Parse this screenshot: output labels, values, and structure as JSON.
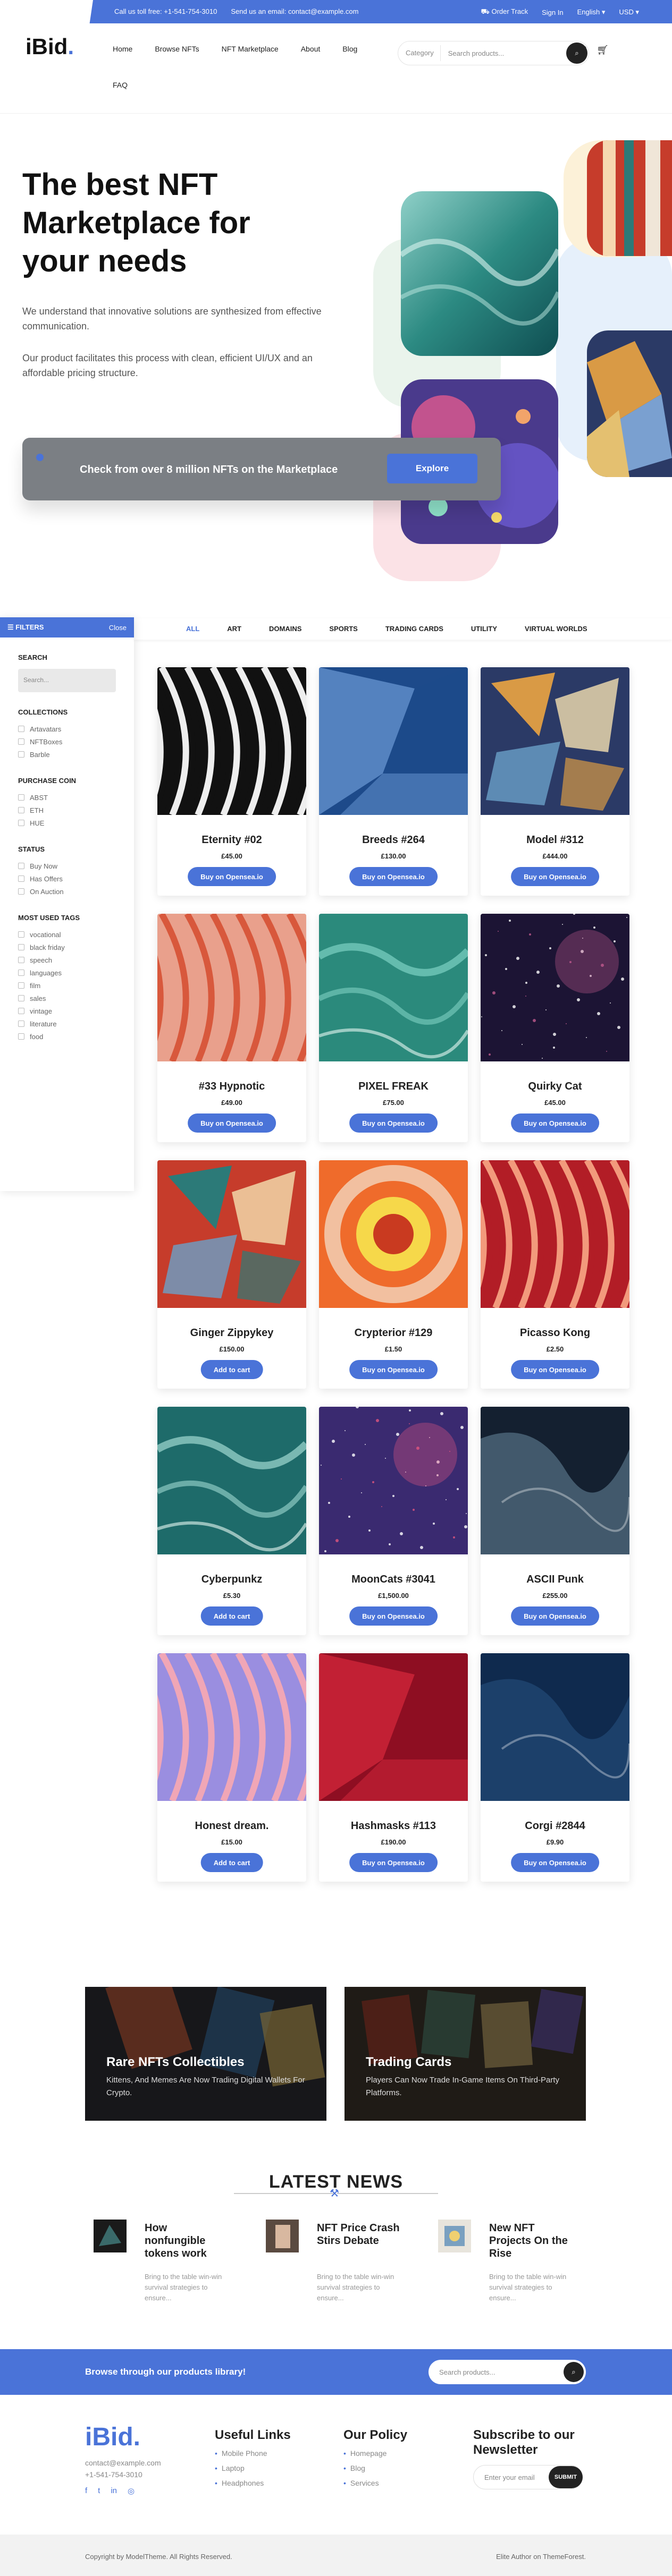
{
  "topbar": {
    "call": "Call us toll free: +1-541-754-3010",
    "email": "Send us an email: contact@example.com",
    "order_track": "Order Track",
    "sign_in": "Sign In",
    "language": "English",
    "currency": "USD"
  },
  "header": {
    "logo_text": "iBid",
    "logo_dot": ".",
    "nav": [
      "Home",
      "Browse NFTs",
      "NFT Marketplace",
      "About",
      "Blog"
    ],
    "nav_second_row": "FAQ",
    "search": {
      "category": "Category",
      "placeholder": "Search products..."
    }
  },
  "hero": {
    "title": "The best NFT Marketplace for your needs",
    "p1": "We understand that innovative solutions are synthesized from effective communication.",
    "p2": "Our product facilitates this process with clean, efficient UI/UX and an affordable pricing structure.",
    "cta_text": "Check from over 8 million NFTs on the Marketplace",
    "cta_button": "Explore"
  },
  "filters": {
    "title": "FILTERS",
    "close": "Close",
    "search_heading": "SEARCH",
    "search_placeholder": "Search...",
    "collections_heading": "COLLECTIONS",
    "collections": [
      "Artavatars",
      "NFTBoxes",
      "Barble"
    ],
    "coin_heading": "PURCHASE COIN",
    "coins": [
      "ABST",
      "ETH",
      "HUE"
    ],
    "status_heading": "STATUS",
    "status": [
      "Buy Now",
      "Has Offers",
      "On Auction"
    ],
    "tags_heading": "MOST USED TAGS",
    "tags": [
      "vocational",
      "black friday",
      "speech",
      "languages",
      "film",
      "sales",
      "vintage",
      "literature",
      "food"
    ]
  },
  "tabs": [
    "ALL",
    "ART",
    "DOMAINS",
    "SPORTS",
    "TRADING CARDS",
    "UTILITY",
    "VIRTUAL WORLDS"
  ],
  "products": [
    {
      "title": "Eternity #02",
      "price": "£45.00",
      "button": "Buy on Opensea.io",
      "colors": [
        "#111",
        "#eee"
      ],
      "pattern": "stripes"
    },
    {
      "title": "Breeds #264",
      "price": "£130.00",
      "button": "Buy on Opensea.io",
      "colors": [
        "#1d4a8a",
        "#6c9ad6"
      ],
      "pattern": "geo"
    },
    {
      "title": "Model #312",
      "price": "£444.00",
      "button": "Buy on Opensea.io",
      "colors": [
        "#2b3a66",
        "#d99a45"
      ],
      "pattern": "shards"
    },
    {
      "title": "#33 Hypnotic",
      "price": "£49.00",
      "button": "Buy on Opensea.io",
      "colors": [
        "#e9a08c",
        "#d8583c"
      ],
      "pattern": "stripes"
    },
    {
      "title": "PIXEL FREAK",
      "price": "£75.00",
      "button": "Buy on Opensea.io",
      "colors": [
        "#2b8a7c",
        "#7ed1c3"
      ],
      "pattern": "water"
    },
    {
      "title": "Quirky Cat",
      "price": "£45.00",
      "button": "Buy on Opensea.io",
      "colors": [
        "#1c1434",
        "#c05a8e"
      ],
      "pattern": "space"
    },
    {
      "title": "Ginger Zippykey",
      "price": "£150.00",
      "button": "Add to cart",
      "colors": [
        "#c63c2b",
        "#2c7a78"
      ],
      "pattern": "shards"
    },
    {
      "title": "Crypterior #129",
      "price": "£1.50",
      "button": "Buy on Opensea.io",
      "colors": [
        "#ef6b2b",
        "#f6d84a"
      ],
      "pattern": "rings"
    },
    {
      "title": "Picasso Kong",
      "price": "£2.50",
      "button": "Buy on Opensea.io",
      "colors": [
        "#b21d26",
        "#f29a7c"
      ],
      "pattern": "stripes"
    },
    {
      "title": "Cyberpunkz",
      "price": "£5.30",
      "button": "Add to cart",
      "colors": [
        "#1e6b6a",
        "#9fd8d2"
      ],
      "pattern": "water"
    },
    {
      "title": "MoonCats #3041",
      "price": "£1,500.00",
      "button": "Buy on Opensea.io",
      "colors": [
        "#3a2a70",
        "#e25680"
      ],
      "pattern": "space"
    },
    {
      "title": "ASCII Punk",
      "price": "£255.00",
      "button": "Buy on Opensea.io",
      "colors": [
        "#142030",
        "#7aa0b6"
      ],
      "pattern": "smoke"
    },
    {
      "title": "Honest dream.",
      "price": "£15.00",
      "button": "Add to cart",
      "colors": [
        "#9a8ee0",
        "#f0a6b6"
      ],
      "pattern": "stripes"
    },
    {
      "title": "Hashmasks #113",
      "price": "£190.00",
      "button": "Buy on Opensea.io",
      "colors": [
        "#8e0e22",
        "#d8283c"
      ],
      "pattern": "geo"
    },
    {
      "title": "Corgi #2844",
      "price": "£9.90",
      "button": "Buy on Opensea.io",
      "colors": [
        "#0f2a4e",
        "#2c5a8e"
      ],
      "pattern": "smoke"
    }
  ],
  "banners": [
    {
      "title": "Rare NFTs Collectibles",
      "text": "Kittens, And Memes Are Now Trading Digital Wallets For Crypto."
    },
    {
      "title": "Trading Cards",
      "text": "Players Can Now Trade In-Game Items On Third-Party Platforms."
    }
  ],
  "news": {
    "title": "LATEST NEWS",
    "items": [
      {
        "title": "How nonfungible tokens work",
        "text": "Bring to the table win-win survival strategies to ensure..."
      },
      {
        "title": "NFT Price Crash Stirs Debate",
        "text": "Bring to the table win-win survival strategies to ensure..."
      },
      {
        "title": "New NFT Projects On the Rise",
        "text": "Bring to the table win-win survival strategies to ensure..."
      }
    ]
  },
  "strip": {
    "text": "Browse through our products library!",
    "placeholder": "Search products..."
  },
  "footer": {
    "logo": "iBid.",
    "email": "contact@example.com",
    "phone": "+1-541-754-3010",
    "useful_title": "Useful Links",
    "useful": [
      "Mobile Phone",
      "Laptop",
      "Headphones"
    ],
    "policy_title": "Our Policy",
    "policy": [
      "Homepage",
      "Blog",
      "Services"
    ],
    "subscribe_title": "Subscribe to our Newsletter",
    "subscribe_placeholder": "Enter your email",
    "subscribe_button": "SUBMIT",
    "copyright": "Copyright by ModelTheme. All Rights Reserved.",
    "credit": "Elite Author on ThemeForest."
  },
  "colors": {
    "accent": "#4a73d8",
    "dark": "#222222"
  }
}
